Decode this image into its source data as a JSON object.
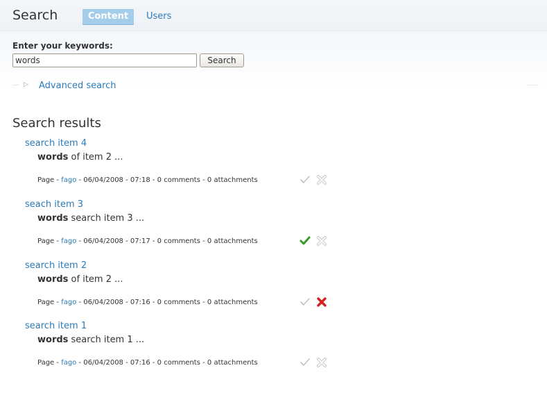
{
  "header": {
    "title": "Search",
    "tabs": [
      {
        "label": "Content",
        "active": true
      },
      {
        "label": "Users",
        "active": false
      }
    ]
  },
  "search_form": {
    "label": "Enter your keywords:",
    "value": "words",
    "button_label": "Search",
    "advanced_label": "Advanced search"
  },
  "results": {
    "title": "Search results",
    "items": [
      {
        "title": "search item 4",
        "snippet_bold": "words",
        "snippet_rest": " of item 2 ...",
        "type": "Page",
        "author": "fago",
        "date": "06/04/2008 - 07:18",
        "comments": "0 comments",
        "attachments": "0 attachments",
        "check_state": "inactive",
        "x_state": "inactive"
      },
      {
        "title": "seach item 3",
        "snippet_bold": "words",
        "snippet_rest": " search item 3 ...",
        "type": "Page",
        "author": "fago",
        "date": "06/04/2008 - 07:17",
        "comments": "0 comments",
        "attachments": "0 attachments",
        "check_state": "active",
        "x_state": "inactive"
      },
      {
        "title": "search item 2",
        "snippet_bold": "words",
        "snippet_rest": " of item 2 ...",
        "type": "Page",
        "author": "fago",
        "date": "06/04/2008 - 07:16",
        "comments": "0 comments",
        "attachments": "0 attachments",
        "check_state": "inactive",
        "x_state": "active"
      },
      {
        "title": "search item 1",
        "snippet_bold": "words",
        "snippet_rest": " search item 1 ...",
        "type": "Page",
        "author": "fago",
        "date": "06/04/2008 - 07:16",
        "comments": "0 comments",
        "attachments": "0 attachments",
        "check_state": "inactive",
        "x_state": "inactive"
      }
    ]
  },
  "colors": {
    "link": "#2b7bb9",
    "active_tab": "#a4cdea",
    "check_active": "#3a9a2a",
    "x_active": "#d42020",
    "icon_inactive": "#c4c4c4"
  }
}
